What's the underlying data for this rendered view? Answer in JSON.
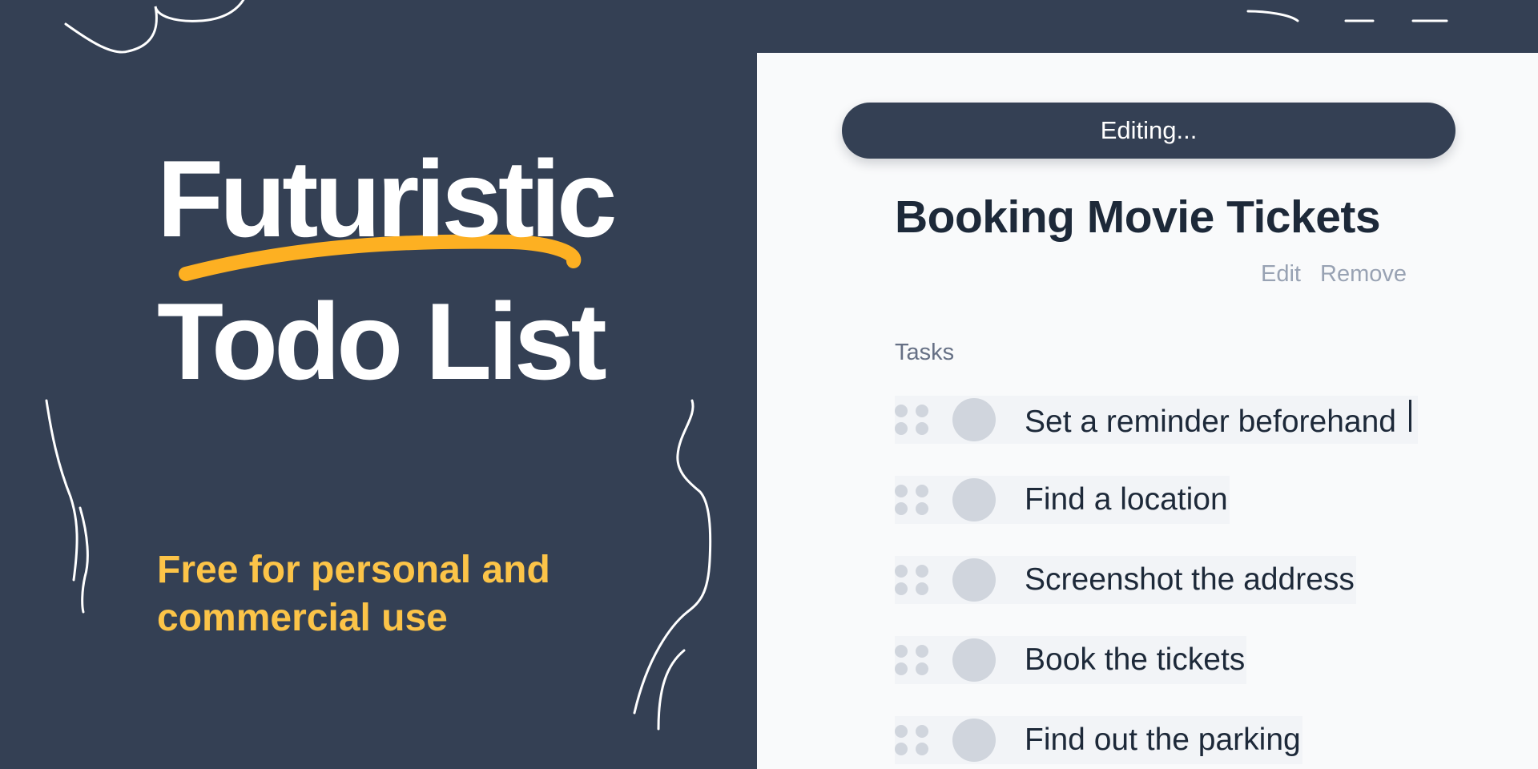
{
  "hero": {
    "title_line1": "Futuristic",
    "title_line2": "Todo List",
    "tagline": "Free for personal and commercial use"
  },
  "editor": {
    "status": "Editing...",
    "title": "Booking Movie Tickets",
    "actions": {
      "edit": "Edit",
      "remove": "Remove"
    },
    "section_label": "Tasks",
    "tasks": [
      {
        "text": "Set a reminder beforehand",
        "editing": true
      },
      {
        "text": "Find a location"
      },
      {
        "text": "Screenshot the address"
      },
      {
        "text": "Book the tickets"
      },
      {
        "text": "Find out the parking"
      }
    ]
  },
  "colors": {
    "background": "#344054",
    "panel": "#f9fafb",
    "accent_underline": "#fdb022",
    "tagline": "#fcc448",
    "row": "#f2f4f7",
    "muted": "#d0d5dd"
  },
  "icons": [
    "drag-handle-icon",
    "check-circle-icon",
    "text-caret-icon"
  ]
}
